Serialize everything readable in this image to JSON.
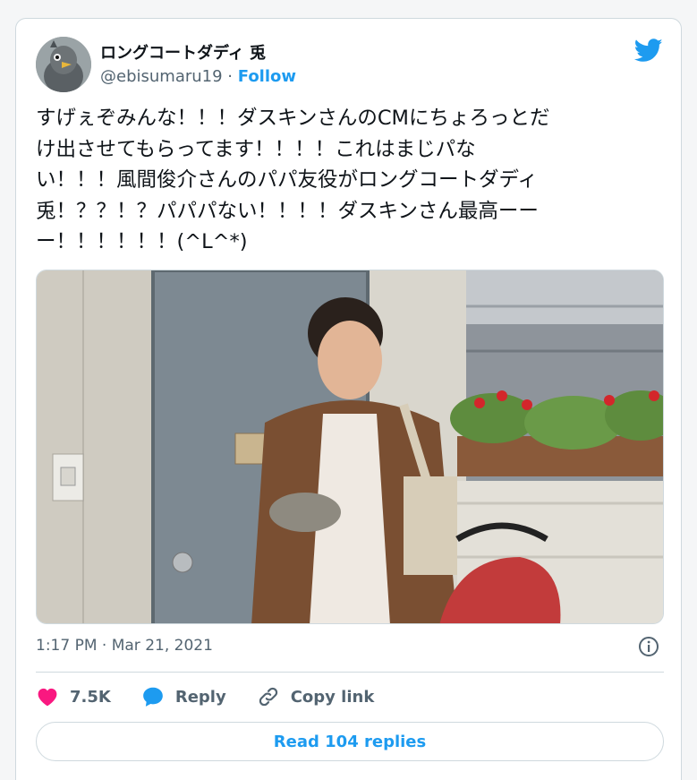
{
  "user": {
    "display_name": "ロングコートダディ 兎",
    "handle": "@ebisumaru19",
    "separator": " · ",
    "follow_label": "Follow"
  },
  "tweet": {
    "lines": [
      "すげぇぞみんな！！！ダスキンさんのCMにちょろっとだ",
      "け出させてもらってます！！！！これはまじパな",
      "い！！！風間俊介さんのパパ友役がロングコートダディ",
      "兎！？？！？パパパない！！！！ダスキンさん最高ーー",
      "ー！！！！！！(^L^*)"
    ],
    "timestamp": "1:17 PM · Mar 21, 2021"
  },
  "actions": {
    "like_count": "7.5K",
    "reply_label": "Reply",
    "copy_link_label": "Copy link"
  },
  "read_replies_label": "Read 104 replies",
  "icons": {
    "logo": "twitter-bird-icon",
    "info": "info-icon",
    "like": "heart-icon",
    "reply": "speech-bubble-icon",
    "copy": "link-icon"
  },
  "colors": {
    "accent": "#1d9bf0",
    "like": "#f91880",
    "muted": "#536471",
    "border": "#cfd9de"
  }
}
